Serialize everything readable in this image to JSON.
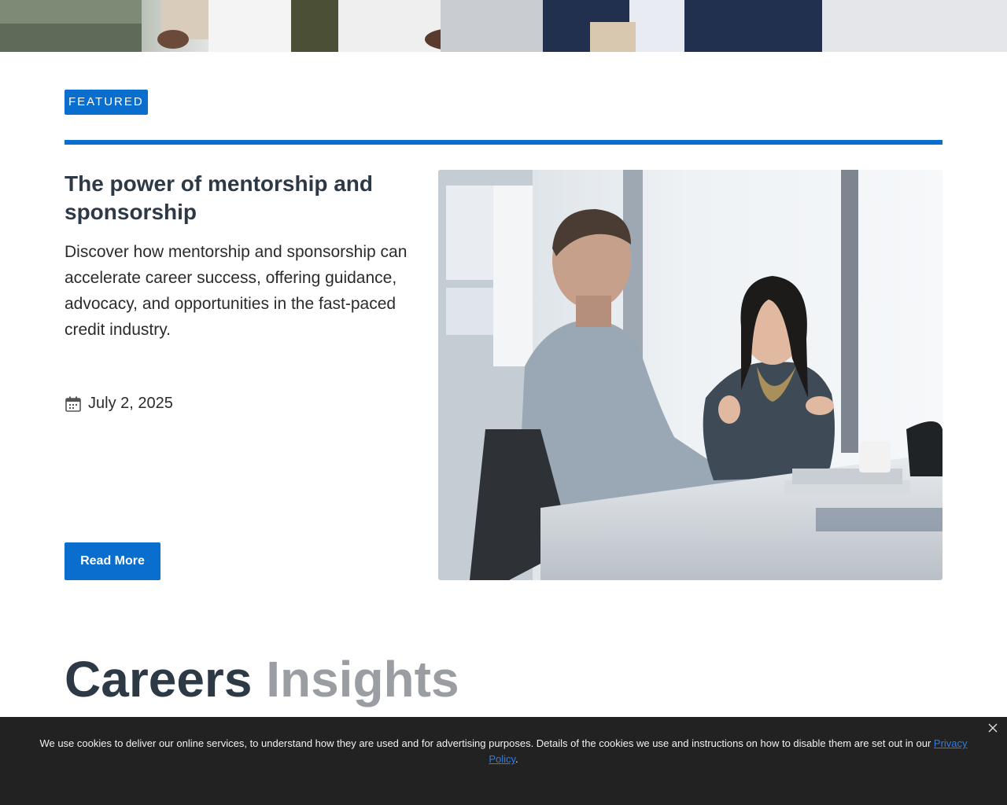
{
  "featured": {
    "badge": "FEATURED",
    "title": "The power of mentorship and sponsorship",
    "description": "Discover how mentorship and sponsorship can accelerate career success, offering guidance, advocacy, and opportunities in the fast-paced credit industry.",
    "date": "July 2, 2025",
    "button_label": "Read More"
  },
  "section": {
    "heading_word1": "Careers",
    "heading_word2": "Insights"
  },
  "cookie_banner": {
    "text": "We use cookies to deliver our online services, to understand how they are used and for advertising purposes. Details of the cookies we use and instructions on how to disable them are set out in our ",
    "link_text": "Privacy Policy",
    "trailing": "."
  },
  "colors": {
    "accent": "#0a6ecf",
    "heading": "#2d3945",
    "heading_muted": "#9a9ea3",
    "cookie_bg": "#222222"
  },
  "icons": [
    "calendar-icon",
    "close-icon"
  ]
}
